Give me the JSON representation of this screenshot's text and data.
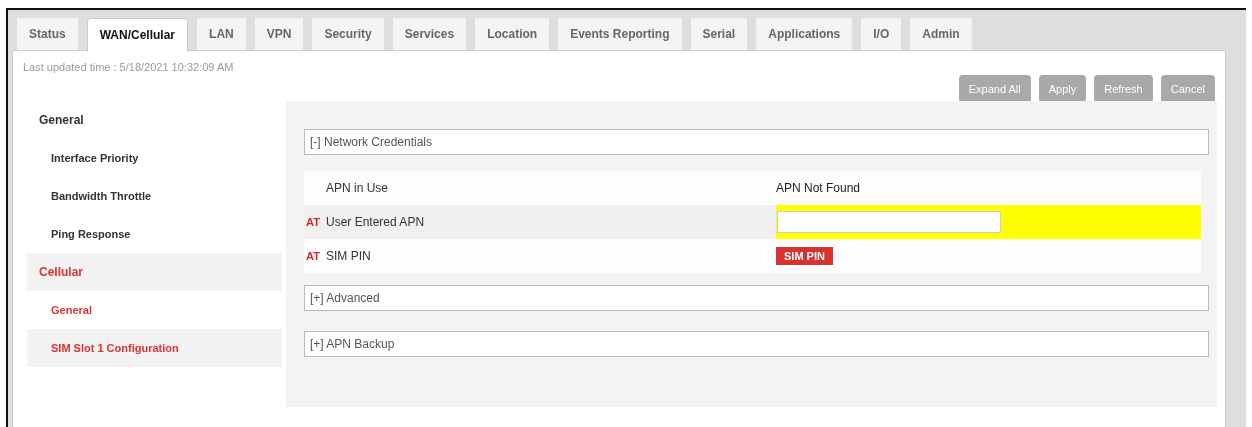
{
  "tabs": [
    {
      "label": "Status",
      "selected": false
    },
    {
      "label": "WAN/Cellular",
      "selected": true
    },
    {
      "label": "LAN",
      "selected": false
    },
    {
      "label": "VPN",
      "selected": false
    },
    {
      "label": "Security",
      "selected": false
    },
    {
      "label": "Services",
      "selected": false
    },
    {
      "label": "Location",
      "selected": false
    },
    {
      "label": "Events Reporting",
      "selected": false
    },
    {
      "label": "Serial",
      "selected": false
    },
    {
      "label": "Applications",
      "selected": false
    },
    {
      "label": "I/O",
      "selected": false
    },
    {
      "label": "Admin",
      "selected": false
    }
  ],
  "last_updated": "Last updated time : 5/18/2021 10:32:09 AM",
  "buttons": [
    "Expand All",
    "Apply",
    "Refresh",
    "Cancel"
  ],
  "sidebar": {
    "items": [
      {
        "kind": "section",
        "label": "General",
        "selected": false
      },
      {
        "kind": "item",
        "label": "Interface Priority",
        "selected": false
      },
      {
        "kind": "item",
        "label": "Bandwidth Throttle",
        "selected": false
      },
      {
        "kind": "item",
        "label": "Ping Response",
        "selected": false
      },
      {
        "kind": "section",
        "label": "Cellular",
        "selected": true
      },
      {
        "kind": "item",
        "label": "General",
        "selected": true
      },
      {
        "kind": "item",
        "label": "SIM Slot 1 Configuration",
        "selected": true
      }
    ]
  },
  "panels": [
    {
      "title": "[-] Network Credentials",
      "rows": [
        {
          "label": "APN in Use",
          "kind": "text",
          "value": "APN Not Found"
        },
        {
          "label": "User Entered APN",
          "at_mark": "AT",
          "kind": "input",
          "highlighted": true
        },
        {
          "label": "SIM PIN",
          "at_mark": "AT",
          "kind": "badge",
          "value": "SIM PIN"
        }
      ]
    },
    {
      "title": "[+] Advanced"
    },
    {
      "title": "[+] APN Backup"
    }
  ]
}
